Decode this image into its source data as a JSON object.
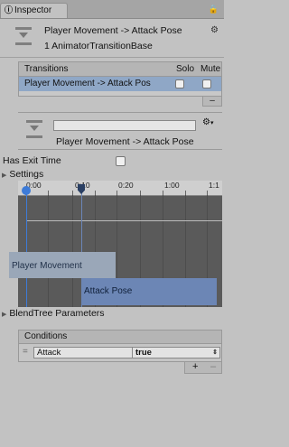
{
  "tab": {
    "icon": "⓿",
    "label": "Inspector"
  },
  "header": {
    "title": "Player Movement -> Attack Pose",
    "subtitle": "1 AnimatorTransitionBase"
  },
  "transitions": {
    "header": "Transitions",
    "solo_label": "Solo",
    "mute_label": "Mute",
    "rows": [
      {
        "label": "Player Movement -> Attack Pos"
      }
    ],
    "remove_label": "–"
  },
  "detail": {
    "name_value": "",
    "caption": "Player Movement -> Attack Pose"
  },
  "has_exit_time": {
    "label": "Has Exit Time"
  },
  "settings": {
    "label": "Settings"
  },
  "timeline": {
    "ticks": [
      "0:00",
      "0:10",
      "0:20",
      "1:00",
      "1:1"
    ],
    "state_a": "Player Movement",
    "state_b": "Attack Pose"
  },
  "blendtree": {
    "label": "BlendTree Parameters"
  },
  "conditions": {
    "header": "Conditions",
    "rows": [
      {
        "parameter": "Attack",
        "value": "true"
      }
    ],
    "add_label": "+",
    "remove_label": "–"
  }
}
